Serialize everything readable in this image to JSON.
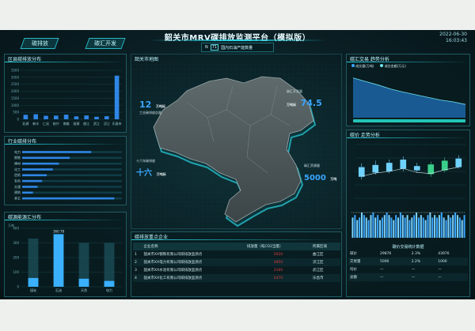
{
  "header": {
    "title": "韶关市MRV碳排放监测平台（模拟版）",
    "nav_left": "碳排放",
    "nav_right": "碳汇开发",
    "date": "2022-06-30",
    "time": "16:03:43",
    "filter_chips": [
      "N",
      "71",
      "国内石油产能数量"
    ]
  },
  "colors": {
    "accent": "#28d6e6",
    "bar": "#2f86e6",
    "danger": "#e03a3a"
  },
  "left_top": {
    "title": "区县碳排放分布",
    "y_ticks": [
      "3500",
      "3000",
      "2500",
      "2000",
      "1500",
      "1000",
      "500",
      "0"
    ],
    "categories": [
      "乳源",
      "新丰",
      "仁化",
      "始兴",
      "南雄",
      "翁源",
      "曲江",
      "武江",
      "浈江",
      "乐昌市"
    ],
    "values": [
      320,
      360,
      250,
      260,
      330,
      210,
      270,
      180,
      220,
      3120
    ],
    "y_max": 3500
  },
  "left_mid": {
    "title": "行业碳排分布",
    "categories": [
      "电力",
      "钢铁",
      "建材",
      "化工",
      "造纸",
      "有色",
      "交通",
      "建筑",
      "其它"
    ],
    "values": [
      90,
      62,
      48,
      40,
      32,
      26,
      20,
      14,
      120
    ],
    "x_max": 130
  },
  "left_bottom": {
    "title": "碳源能源汇分布",
    "y_label": "万吨",
    "y_ticks": [
      "400",
      "300",
      "200",
      "100",
      "0"
    ],
    "categories": [
      "煤炭",
      "石油",
      "天然",
      "电力"
    ],
    "values": [
      60,
      360,
      55,
      40
    ],
    "bg_values": [
      330,
      360,
      300,
      300
    ],
    "top_label": "360.78",
    "y_max": 400
  },
  "map": {
    "title": "韶关市地图",
    "labels": [
      {
        "value": "12",
        "unit": "万吨标",
        "color": "#3aa6ff"
      },
      {
        "value": "74.5",
        "unit": "万吨标",
        "color": "#3aa6ff"
      },
      {
        "value": "十六",
        "unit": "万吨标",
        "color": "#3aa6ff"
      },
      {
        "value": "5000",
        "unit": "万吨",
        "color": "#3aa6ff"
      }
    ],
    "captions": [
      "工业碳排放总量",
      "碳汇开发量",
      "十六年碳排放",
      "碳汇资源量"
    ]
  },
  "table": {
    "title": "碳排放重点企业",
    "headers": [
      "",
      "企业名称",
      "排放量（吨CO2当量）",
      "所属区域"
    ],
    "rows": [
      [
        "1",
        "韶关市XX钢铁有限公司碳排放监测点",
        "5620",
        "曲江区"
      ],
      [
        "2",
        "韶关市XX电力有限公司碳排放监测点",
        "4850",
        "浈江区"
      ],
      [
        "3",
        "韶关市XX水泥有限公司碳排放监测点",
        "3160",
        "武江区"
      ],
      [
        "4",
        "韶关市XX化工有限公司碳排放监测点",
        "2470",
        "乐昌市"
      ]
    ]
  },
  "right_top": {
    "title": "碳汇交易 趋势分析",
    "legend": [
      "成交量(万吨)",
      "成交金额(万元)"
    ],
    "line_values": [
      90,
      82,
      74,
      65,
      58,
      52,
      46,
      40,
      36,
      30
    ],
    "y_max": 100
  },
  "right_mid": {
    "title": "碳价 走势分析",
    "candles": [
      {
        "open": 40,
        "close": 58,
        "high": 65,
        "low": 35,
        "up": false
      },
      {
        "open": 62,
        "close": 48,
        "high": 70,
        "low": 44,
        "up": false
      },
      {
        "open": 50,
        "close": 66,
        "high": 72,
        "low": 46,
        "up": false
      },
      {
        "open": 55,
        "close": 72,
        "high": 78,
        "low": 50,
        "up": false
      },
      {
        "open": 60,
        "close": 52,
        "high": 66,
        "low": 48,
        "up": false
      },
      {
        "open": 45,
        "close": 63,
        "high": 68,
        "low": 40,
        "up": true
      },
      {
        "open": 52,
        "close": 70,
        "high": 76,
        "low": 48,
        "up": true
      },
      {
        "open": 58,
        "close": 74,
        "high": 80,
        "low": 55,
        "up": false
      }
    ],
    "micro_values": [
      8,
      9,
      7,
      8,
      10,
      9,
      8,
      7,
      9,
      10,
      8,
      9,
      7,
      8,
      9,
      10,
      9,
      8,
      7,
      9,
      8,
      10,
      9,
      8,
      9,
      7,
      8,
      9,
      10,
      8,
      9,
      8,
      7,
      9,
      10,
      8,
      9,
      8,
      9,
      10,
      8,
      7,
      9,
      8,
      9,
      10,
      9,
      8,
      7,
      9
    ],
    "summary_title": "碳价交易统计数据",
    "summary": [
      [
        "碳价",
        "29876",
        "2.3%",
        "43976"
      ],
      [
        "交易量",
        "5000",
        "2.2%",
        "1000"
      ],
      [
        "均价",
        "—",
        "—",
        "—"
      ],
      [
        "总额",
        "—",
        "—",
        "—"
      ]
    ]
  }
}
